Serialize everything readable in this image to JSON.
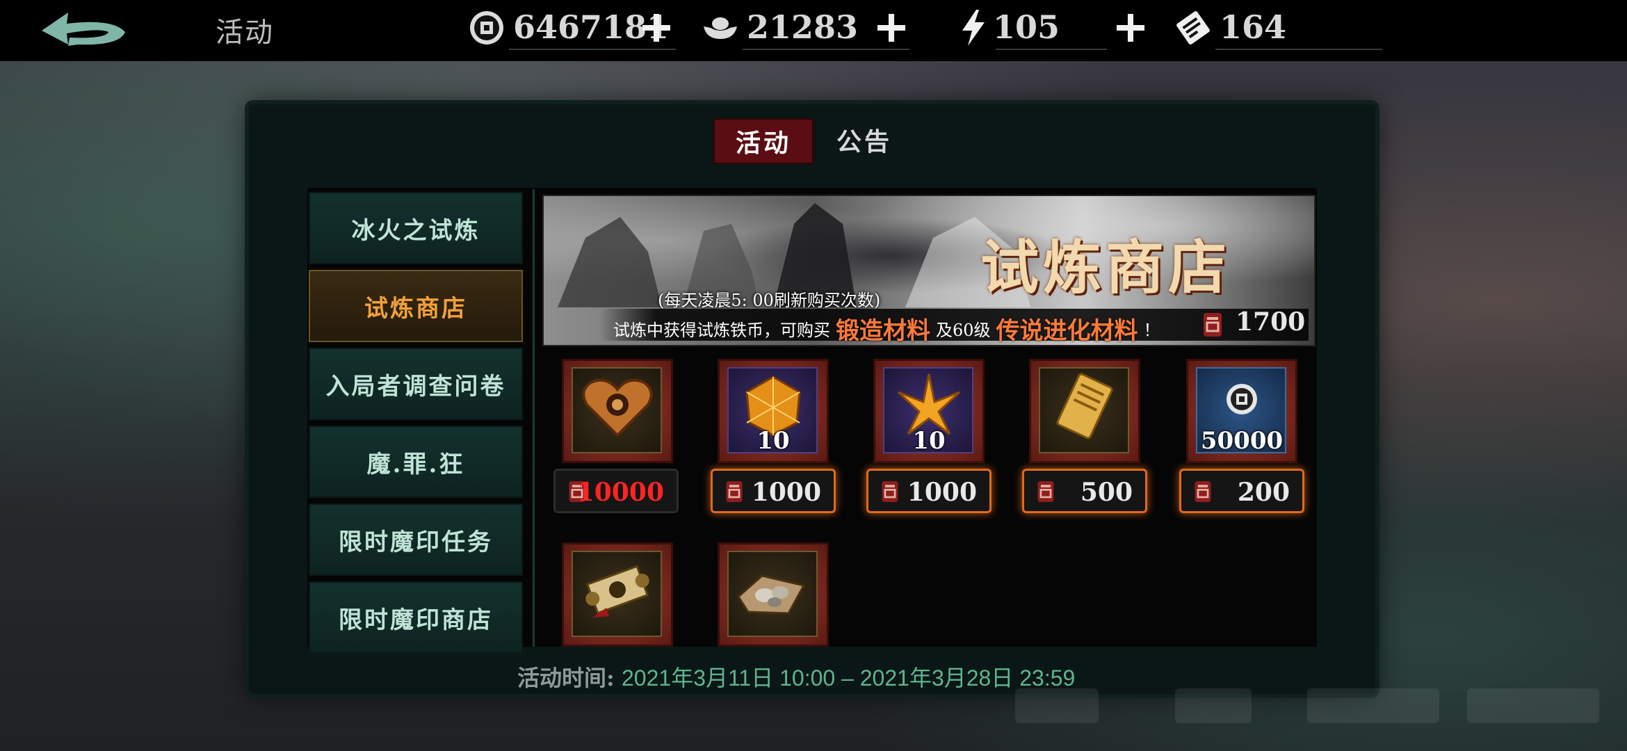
{
  "header": {
    "title": "活动",
    "resources": [
      {
        "icon": "copper-coin-icon",
        "value": "6467181",
        "addable": true
      },
      {
        "icon": "silver-ingot-icon",
        "value": "21283",
        "addable": true
      },
      {
        "icon": "lightning-stamina-icon",
        "value": "105",
        "addable": true
      },
      {
        "icon": "ticket-icon",
        "value": "164",
        "addable": false
      }
    ]
  },
  "tabs": [
    {
      "label": "活动",
      "active": true
    },
    {
      "label": "公告",
      "active": false
    }
  ],
  "menu": [
    {
      "label": "冰火之试炼",
      "selected": false
    },
    {
      "label": "试炼商店",
      "selected": true
    },
    {
      "label": "入局者调查问卷",
      "selected": false
    },
    {
      "label": "魔.罪.狂",
      "selected": false
    },
    {
      "label": "限时魔印任务",
      "selected": false
    },
    {
      "label": "限时魔印商店",
      "selected": false
    }
  ],
  "banner": {
    "title": "试炼商店",
    "note": "(每天凌晨5: 00刷新购买次数)",
    "desc_prefix": "试炼中获得试炼铁币，可购买",
    "desc_hl1": "锻造材料",
    "desc_mid": "及60级",
    "desc_hl2": "传说进化材料",
    "desc_suffix": "！",
    "balance": "1700"
  },
  "items": [
    {
      "icon": "heart-amulet-icon",
      "qty": "",
      "price": "10000",
      "affordable": false
    },
    {
      "icon": "amber-gem-icon",
      "qty": "10",
      "price": "1000",
      "affordable": true
    },
    {
      "icon": "crystal-shard-icon",
      "qty": "10",
      "price": "1000",
      "affordable": true
    },
    {
      "icon": "gold-scroll-icon",
      "qty": "",
      "price": "500",
      "affordable": true
    },
    {
      "icon": "copper-coin-icon",
      "qty": "50000",
      "price": "200",
      "affordable": true
    },
    {
      "icon": "ancient-scroll-icon",
      "qty": "",
      "price": "",
      "affordable": true
    },
    {
      "icon": "ore-pile-icon",
      "qty": "",
      "price": "",
      "affordable": true
    }
  ],
  "footer": {
    "label": "活动时间:",
    "time": "2021年3月11日 10:00 – 2021年3月28日 23:59"
  },
  "colors": {
    "accent_orange": "#e06a1c",
    "tab_active": "#5a0d12",
    "menu_text": "#bfe3d6",
    "menu_selected_text": "#f2a13a",
    "price_unaffordable": "#ff2424",
    "time_text": "#5fb58e"
  }
}
